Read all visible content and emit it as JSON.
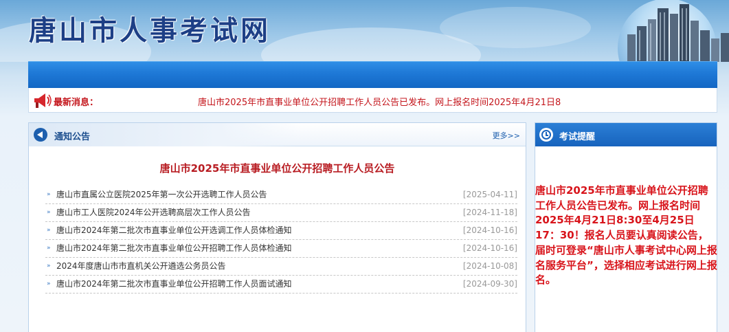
{
  "header": {
    "site_title": "唐山市人事考试网"
  },
  "news": {
    "label": "最新消息：",
    "text": "唐山市2025年市直事业单位公开招聘工作人员公告已发布。网上报名时间2025年4月21日8"
  },
  "notice": {
    "title": "通知公告",
    "more": "更多>>",
    "headline": "唐山市2025年市直事业单位公开招聘工作人员公告",
    "items": [
      {
        "title": "唐山市直属公立医院2025年第一次公开选聘工作人员公告",
        "date": "[2025-04-11]"
      },
      {
        "title": "唐山市工人医院2024年公开选聘高层次工作人员公告",
        "date": "[2024-11-18]"
      },
      {
        "title": "唐山市2024年第二批次市直事业单位公开选调工作人员体检通知",
        "date": "[2024-10-16]"
      },
      {
        "title": "唐山市2024年第二批次市直事业单位公开招聘工作人员体检通知",
        "date": "[2024-10-16]"
      },
      {
        "title": "2024年度唐山市市直机关公开遴选公务员公告",
        "date": "[2024-10-08]"
      },
      {
        "title": "唐山市2024年第二批次市直事业单位公开招聘工作人员面试通知",
        "date": "[2024-09-30]"
      }
    ]
  },
  "exam_reminder": {
    "title": "考试提醒",
    "text": "唐山市2025年市直事业单位公开招聘工作人员公告已发布。网上报名时间2025年4月21日8:30至4月25日17：30！报名人员要认真阅读公告，届时可登录“唐山市人事考试中心网上报名服务平台”，选择相应考试进行网上报名。"
  },
  "colors": {
    "accent_red": "#c4161c",
    "nav_blue": "#1e78d6",
    "title_blue": "#1d3f86"
  }
}
